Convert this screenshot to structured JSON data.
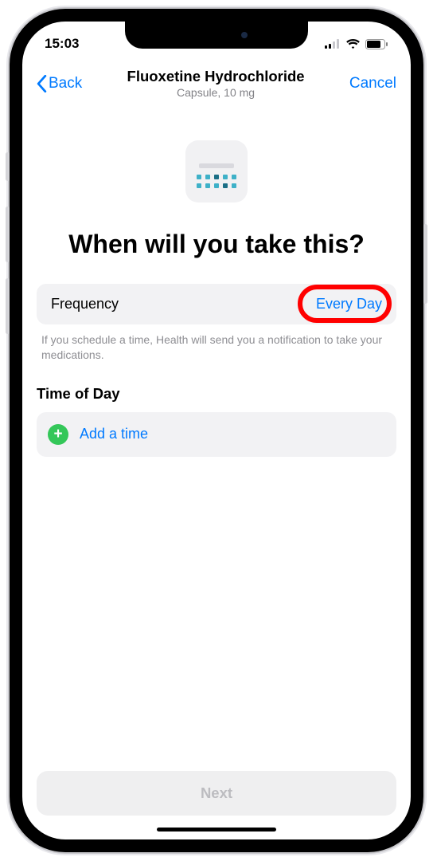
{
  "status": {
    "time": "15:03"
  },
  "nav": {
    "back": "Back",
    "title": "Fluoxetine Hydrochloride",
    "subtitle": "Capsule, 10 mg",
    "cancel": "Cancel"
  },
  "heading": "When will you take this?",
  "frequency": {
    "label": "Frequency",
    "value": "Every Day"
  },
  "helper": "If you schedule a time, Health will send you a notification to take your medications.",
  "timeOfDay": {
    "heading": "Time of Day",
    "add": "Add a time"
  },
  "next": "Next"
}
